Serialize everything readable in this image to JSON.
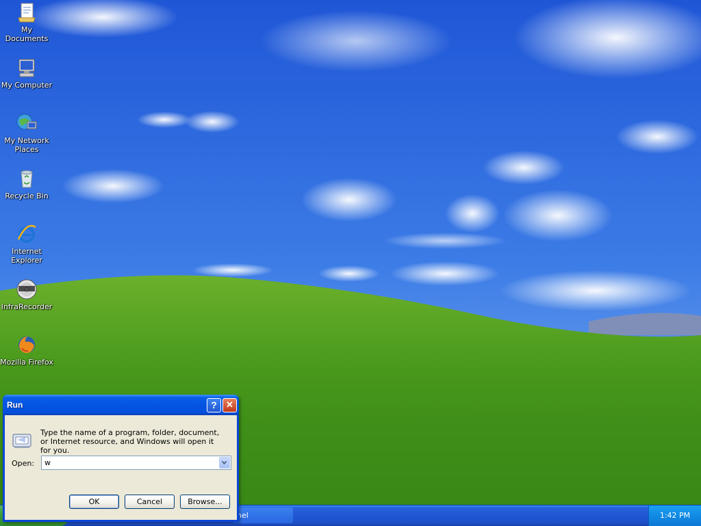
{
  "desktop": {
    "icons": [
      {
        "label": "My Documents",
        "icon": "documents-folder-icon"
      },
      {
        "label": "My Computer",
        "icon": "computer-icon"
      },
      {
        "label": "My Network Places",
        "icon": "network-places-icon"
      },
      {
        "label": "Recycle Bin",
        "icon": "recycle-bin-icon"
      },
      {
        "label": "Internet Explorer",
        "icon": "internet-explorer-icon"
      },
      {
        "label": "InfraRecorder",
        "icon": "infrarecorder-icon"
      },
      {
        "label": "Mozilla Firefox",
        "icon": "firefox-icon"
      }
    ]
  },
  "run_dialog": {
    "title": "Run",
    "help_symbol": "?",
    "close_symbol": "✕",
    "prompt": "Type the name of a program, folder, document, or Internet resource, and Windows will open it for you.",
    "open_label": "Open:",
    "open_value": "w",
    "buttons": {
      "ok": "OK",
      "cancel": "Cancel",
      "browse": "Browse..."
    }
  },
  "taskbar": {
    "task_item_label": "nel",
    "clock": "1:42 PM"
  },
  "colors": {
    "title_bar": "#0554e3",
    "dialog_face": "#ece9d8",
    "taskbar": "#2157d4",
    "tray": "#118be5"
  }
}
